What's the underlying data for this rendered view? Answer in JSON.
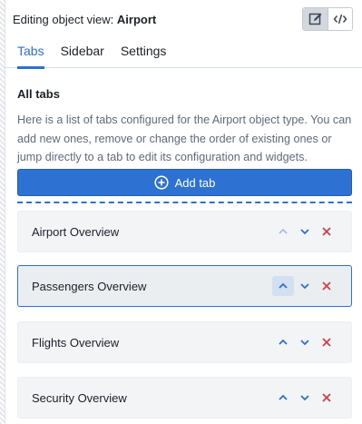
{
  "header": {
    "title_prefix": "Editing object view: ",
    "object_name": "Airport",
    "mode_buttons": [
      {
        "icon": "edit-icon",
        "active": true
      },
      {
        "icon": "code-icon",
        "active": false
      }
    ]
  },
  "tabs": [
    {
      "label": "Tabs",
      "active": true
    },
    {
      "label": "Sidebar",
      "active": false
    },
    {
      "label": "Settings",
      "active": false
    }
  ],
  "section": {
    "title": "All tabs",
    "description": "Here is a list of tabs configured for the Airport object type. You can add new ones, remove or change the order of existing ones or jump directly to a tab to edit its configuration and widgets."
  },
  "add_button": {
    "label": "Add tab",
    "icon": "plus-circle-icon"
  },
  "tab_list": [
    {
      "label": "Airport Overview",
      "up_disabled": true,
      "selected": false
    },
    {
      "label": "Passengers Overview",
      "up_disabled": false,
      "selected": true
    },
    {
      "label": "Flights Overview",
      "up_disabled": false,
      "selected": false
    },
    {
      "label": "Security Overview",
      "up_disabled": false,
      "selected": false
    }
  ],
  "colors": {
    "accent": "#2d72d2",
    "danger": "#cd4246",
    "disabled": "#a7c1e6",
    "row_background": "#f3f4f6"
  }
}
